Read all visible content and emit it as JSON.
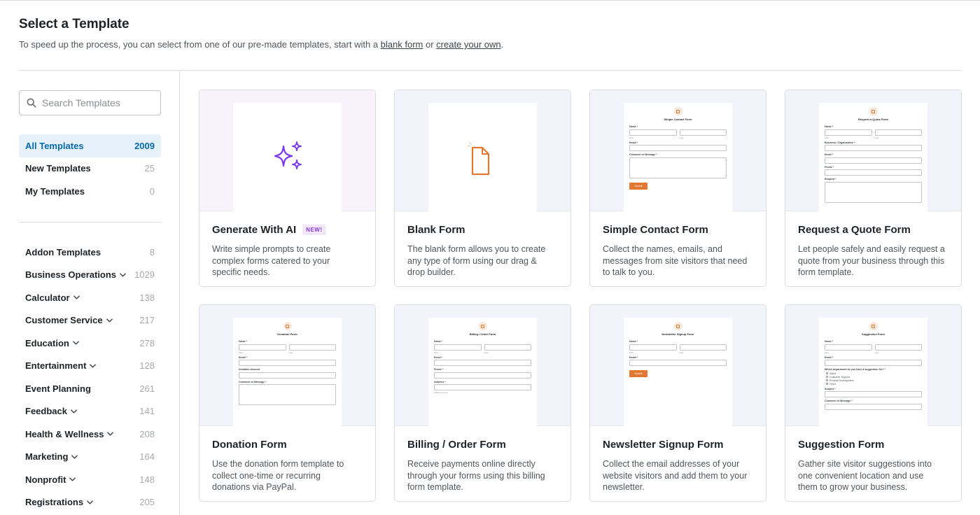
{
  "header": {
    "title": "Select a Template",
    "subtitle_before": "To speed up the process, you can select from one of our pre-made templates, start with a ",
    "blank_link": "blank form",
    "subtitle_middle": " or ",
    "own_link": "create your own",
    "subtitle_end": "."
  },
  "search": {
    "placeholder": "Search Templates"
  },
  "nav": [
    {
      "label": "All Templates",
      "count": "2009"
    },
    {
      "label": "New Templates",
      "count": "25"
    },
    {
      "label": "My Templates",
      "count": "0"
    }
  ],
  "categories": [
    {
      "label": "Addon Templates",
      "count": "8",
      "chevron": false
    },
    {
      "label": "Business Operations",
      "count": "1029",
      "chevron": true
    },
    {
      "label": "Calculator",
      "count": "138",
      "chevron": true
    },
    {
      "label": "Customer Service",
      "count": "217",
      "chevron": true
    },
    {
      "label": "Education",
      "count": "278",
      "chevron": true
    },
    {
      "label": "Entertainment",
      "count": "128",
      "chevron": true
    },
    {
      "label": "Event Planning",
      "count": "261",
      "chevron": false
    },
    {
      "label": "Feedback",
      "count": "141",
      "chevron": true
    },
    {
      "label": "Health & Wellness",
      "count": "208",
      "chevron": true
    },
    {
      "label": "Marketing",
      "count": "164",
      "chevron": true
    },
    {
      "label": "Nonprofit",
      "count": "148",
      "chevron": true
    },
    {
      "label": "Registrations",
      "count": "205",
      "chevron": true
    }
  ],
  "templates": [
    {
      "title": "Generate With AI",
      "badge": "NEW!",
      "description": "Write simple prompts to create complex forms catered to your specific needs."
    },
    {
      "title": "Blank Form",
      "description": "The blank form allows you to create any type of form using our drag & drop builder."
    },
    {
      "title": "Simple Contact Form",
      "description": "Collect the names, emails, and messages from site visitors that need to talk to you."
    },
    {
      "title": "Request a Quote Form",
      "description": "Let people safely and easily request a quote from your business through this form template."
    },
    {
      "title": "Donation Form",
      "description": "Use the donation form template to collect one-time or recurring donations via PayPal."
    },
    {
      "title": "Billing / Order Form",
      "description": "Receive payments online directly through your forms using this billing form template."
    },
    {
      "title": "Newsletter Signup Form",
      "description": "Collect the email addresses of your website visitors and add them to your newsletter."
    },
    {
      "title": "Suggestion Form",
      "description": "Gather site visitor suggestions into one convenient location and use them to grow your business."
    }
  ],
  "previews": {
    "contact": {
      "title": "Simple Contact Form",
      "name": "Name *",
      "first": "First",
      "last": "Last",
      "email": "Email *",
      "comment": "Comment or Message *",
      "submit": "Submit"
    },
    "quote": {
      "title": "Request a Quote Form",
      "name": "Name *",
      "first": "First",
      "last": "Last",
      "business": "Business / Organization *",
      "email": "Email *",
      "phone": "Phone *",
      "request": "Request *"
    },
    "donation": {
      "title": "Donation Form",
      "name": "Name *",
      "first": "First",
      "last": "Last",
      "email": "Email *",
      "amount": "Donation Amount",
      "comment": "Comment or Message *"
    },
    "billing": {
      "title": "Billing / Order Form",
      "name": "Name *",
      "first": "First",
      "last": "Last",
      "email": "Email *",
      "phone": "Phone *",
      "address": "Address *",
      "address1": "Address Line 1"
    },
    "newsletter": {
      "title": "Newsletter Signup Form",
      "name": "Name *",
      "first": "First",
      "last": "Last",
      "email": "Email *",
      "submit": "Submit"
    },
    "suggestion": {
      "title": "Suggestion Form",
      "name": "Name *",
      "first": "First",
      "last": "Last",
      "email": "Email *",
      "question": "Which department do you have a suggestion for? *",
      "options": [
        "Sales",
        "Customer Support",
        "Product Development",
        "Other"
      ],
      "subject": "Subject *",
      "comment": "Comment or Message *"
    }
  },
  "colors": {
    "accent": "#056aab",
    "ai_purple": "#7c3aed",
    "orange": "#e27730"
  }
}
